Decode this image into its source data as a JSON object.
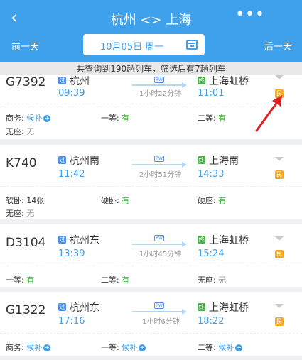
{
  "header": {
    "back_icon": "chevron-left-icon",
    "title": "杭州 <> 上海",
    "more_icon": "ellipsis-icon",
    "prev_day": "前一天",
    "date": "10月05日 周一",
    "calendar_icon": "calendar-icon",
    "next_day": "后一天",
    "bg_color": "#3fa0ec"
  },
  "summary": "共查询到190趟列车，筛选后有7趟列车",
  "trains": [
    {
      "number": "G7392",
      "from_icon": "过",
      "from_station": "杭州",
      "depart": "09:39",
      "duration": "1小时22分钟",
      "to_icon": "终",
      "to_station": "上海虹桥",
      "arrive": "11:01",
      "badge": "民",
      "seats": [
        {
          "label": "商务:",
          "value": "候补"
        },
        {
          "label": "一等:",
          "value": "有"
        },
        {
          "label": "二等:",
          "value": "有"
        },
        {
          "label": "无座:",
          "value": "无"
        }
      ]
    },
    {
      "number": "K740",
      "from_icon": "过",
      "from_station": "杭州南",
      "depart": "11:42",
      "duration": "2小时51分钟",
      "to_icon": "终",
      "to_station": "上海南",
      "arrive": "14:33",
      "badge": "民",
      "seats": [
        {
          "label": "软卧:",
          "value": "14张"
        },
        {
          "label": "硬卧:",
          "value": "有"
        },
        {
          "label": "硬座:",
          "value": "有"
        },
        {
          "label": "无座:",
          "value": "无"
        }
      ]
    },
    {
      "number": "D3104",
      "from_icon": "过",
      "from_station": "杭州东",
      "depart": "13:39",
      "duration": "1小时45分钟",
      "to_icon": "终",
      "to_station": "上海虹桥",
      "arrive": "15:24",
      "badge": "民",
      "seats": [
        {
          "label": "一等:",
          "value": "有"
        },
        {
          "label": "二等:",
          "value": "有"
        },
        {
          "label": "无座:",
          "value": "无"
        }
      ]
    },
    {
      "number": "G1322",
      "from_icon": "过",
      "from_station": "杭州东",
      "depart": "17:16",
      "duration": "1小时6分钟",
      "to_icon": "终",
      "to_station": "上海虹桥",
      "arrive": "18:22",
      "badge": "民",
      "seats": [
        {
          "label": "商务:",
          "value": "候补"
        },
        {
          "label": "一等:",
          "value": "候补"
        },
        {
          "label": "二等:",
          "value": "候补"
        }
      ]
    }
  ],
  "qr_tag_label": "RW",
  "plus_glyph": "+"
}
